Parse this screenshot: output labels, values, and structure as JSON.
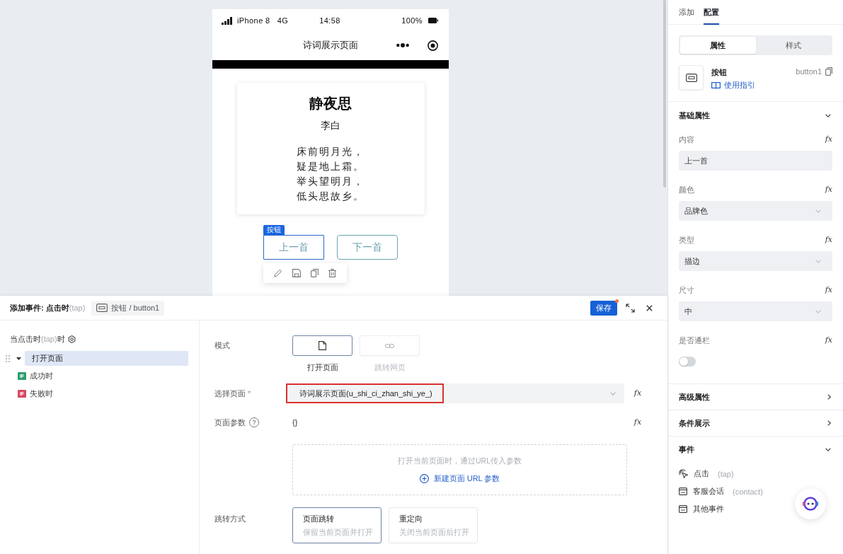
{
  "phone": {
    "status_bar": {
      "device": "iPhone 8",
      "network": "4G",
      "time": "14:58",
      "battery": "100%"
    },
    "nav_bar": {
      "title": "诗词展示页面"
    },
    "poem": {
      "title": "静夜思",
      "author": "李白",
      "lines": [
        "床前明月光，",
        "疑是地上霜。",
        "举头望明月，",
        "低头思故乡。"
      ]
    },
    "selection_tag": "按钮",
    "buttons": [
      {
        "label": "上一首",
        "selected": true
      },
      {
        "label": "下一首",
        "selected": false
      }
    ]
  },
  "config_panel": {
    "tabs": [
      {
        "label": "添加",
        "selected": false
      },
      {
        "label": "配置",
        "selected": true
      }
    ],
    "segments": [
      {
        "label": "属性",
        "selected": true
      },
      {
        "label": "样式",
        "selected": false
      }
    ],
    "component": {
      "name": "按钮",
      "guide_link": "使用指引",
      "id": "button1"
    },
    "sections": [
      {
        "title": "基础属性",
        "expanded": true,
        "fields": [
          {
            "kind": "input",
            "label": "内容",
            "formula": "fx",
            "value": "上一首"
          },
          {
            "kind": "select",
            "label": "颜色",
            "formula": "fx",
            "value": "品牌色"
          },
          {
            "kind": "select",
            "label": "类型",
            "formula": "fx",
            "value": "描边"
          },
          {
            "kind": "select",
            "label": "尺寸",
            "formula": "fx",
            "value": "中"
          },
          {
            "kind": "toggle",
            "label": "是否通栏",
            "formula": "fx",
            "on": false
          }
        ]
      },
      {
        "title": "高级属性",
        "expanded": false
      },
      {
        "title": "条件展示",
        "expanded": false
      },
      {
        "title": "事件",
        "expanded": true,
        "events": [
          {
            "label": "点击",
            "code": "(tap)"
          },
          {
            "label": "客服会话",
            "code": "(contact)"
          },
          {
            "label": "其他事件"
          }
        ]
      }
    ]
  },
  "event_panel": {
    "title": {
      "text": "添加事件: 点击时",
      "code": "(tap)"
    },
    "component_chip": "按钮 / button1",
    "save": {
      "label": "保存",
      "unsaved": true
    },
    "trigger": {
      "text": "当点击时",
      "code": "(tap)",
      "suffix": "时"
    },
    "actions": [
      {
        "label": "打开页面",
        "selected": true,
        "expanded": true,
        "children": [
          {
            "badge": "IF",
            "label": "成功时",
            "color": "#2f9e6e"
          },
          {
            "badge": "IF",
            "label": "失败时",
            "color": "#d9465f"
          }
        ]
      }
    ],
    "form": {
      "mode": {
        "label": "模式",
        "options": [
          {
            "label": "打开页面",
            "selected": true
          },
          {
            "label": "跳转网页",
            "selected": false
          }
        ]
      },
      "page": {
        "label": "选择页面",
        "required_mark": "*",
        "value": "诗词展示页面(u_shi_ci_zhan_shi_ye_)",
        "highlighted": true,
        "formula": "fx"
      },
      "params": {
        "label": "页面参数",
        "help": "?",
        "value": "{}",
        "formula": "fx",
        "hint": "打开当前页面时，通过URL传入参数",
        "add_link": "新建页面 URL 参数"
      },
      "jump": {
        "label": "跳转方式",
        "options": [
          {
            "title": "页面跳转",
            "description": "保留当前页面并打开",
            "selected": true
          },
          {
            "title": "重定向",
            "description": "关闭当前页面后打开",
            "selected": false
          }
        ]
      }
    }
  }
}
